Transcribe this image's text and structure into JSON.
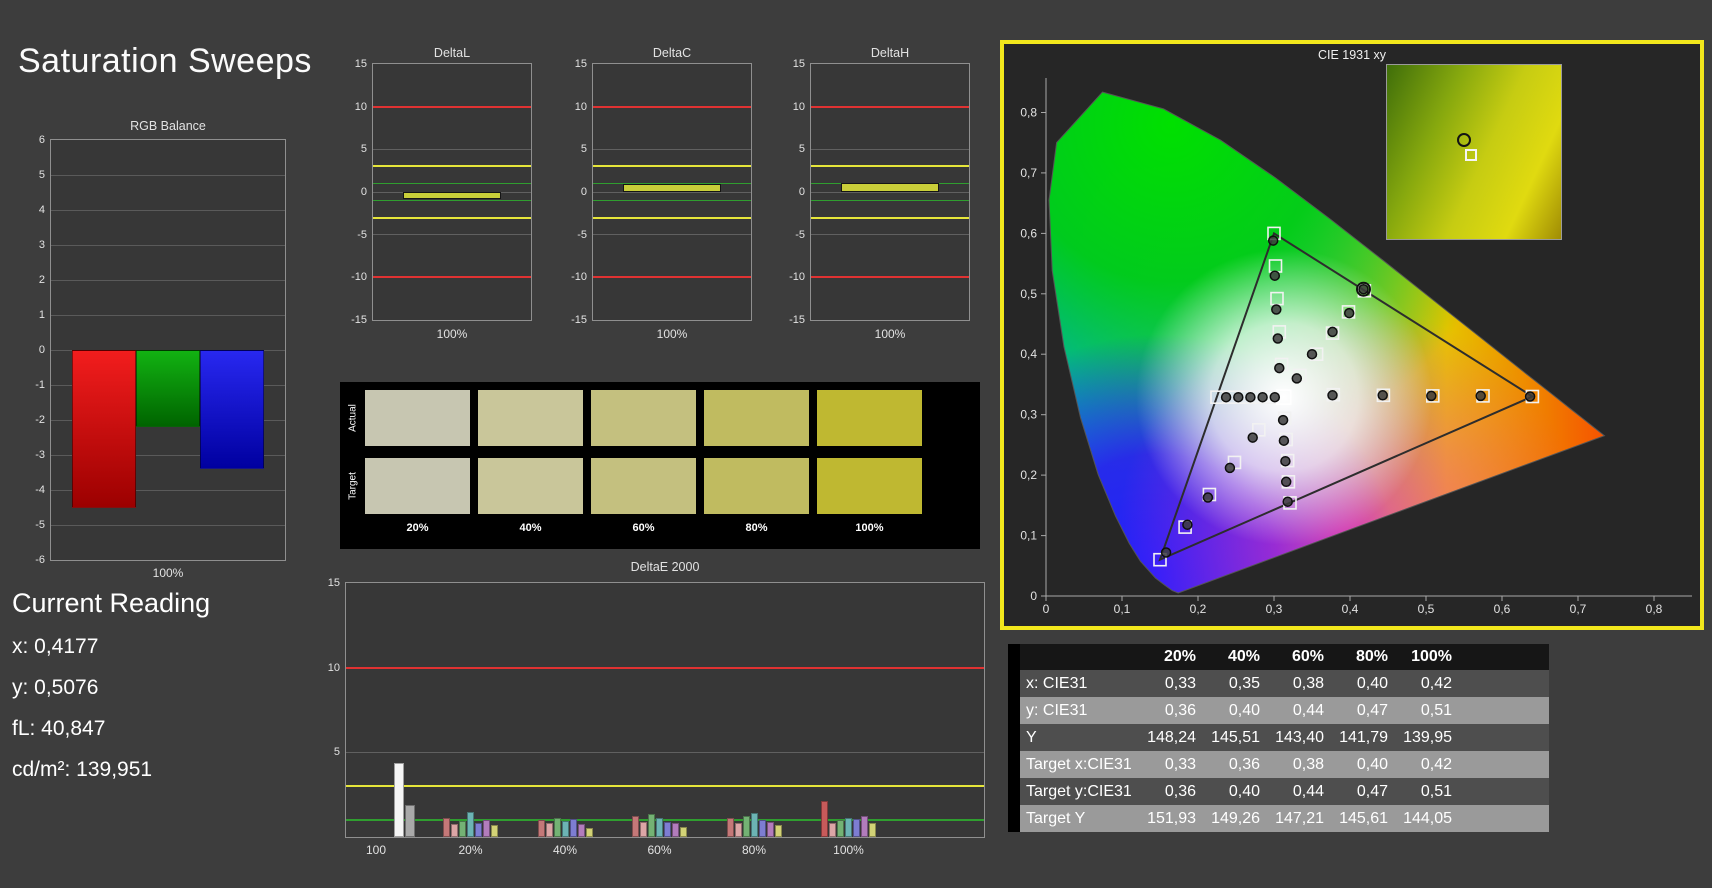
{
  "page": {
    "title": "Saturation Sweeps"
  },
  "current_reading": {
    "heading": "Current Reading",
    "lines": [
      "x: 0,4177",
      "y: 0,5076",
      "fL: 40,847",
      "cd/m²: 139,951"
    ]
  },
  "swatches": {
    "row_labels": [
      "Actual",
      "Target"
    ],
    "col_labels": [
      "20%",
      "40%",
      "60%",
      "80%",
      "100%"
    ],
    "actual_colors": [
      "#c7c6b1",
      "#c9c69a",
      "#c4c07f",
      "#c0bb60",
      "#bfb831"
    ],
    "target_colors": [
      "#c7c6b1",
      "#c9c69a",
      "#c4c07f",
      "#c0bb60",
      "#bfb831"
    ]
  },
  "table": {
    "columns": [
      "20%",
      "40%",
      "60%",
      "80%",
      "100%"
    ],
    "rows": [
      {
        "label": "x: CIE31",
        "values": [
          "0,33",
          "0,35",
          "0,38",
          "0,40",
          "0,42"
        ]
      },
      {
        "label": "y: CIE31",
        "values": [
          "0,36",
          "0,40",
          "0,44",
          "0,47",
          "0,51"
        ]
      },
      {
        "label": "Y",
        "values": [
          "148,24",
          "145,51",
          "143,40",
          "141,79",
          "139,95"
        ]
      },
      {
        "label": "Target x:CIE31",
        "values": [
          "0,33",
          "0,36",
          "0,38",
          "0,40",
          "0,42"
        ]
      },
      {
        "label": "Target y:CIE31",
        "values": [
          "0,36",
          "0,40",
          "0,44",
          "0,47",
          "0,51"
        ]
      },
      {
        "label": "Target Y",
        "values": [
          "151,93",
          "149,26",
          "147,21",
          "145,61",
          "144,05"
        ]
      }
    ]
  },
  "chart_data": [
    {
      "id": "rgb_balance",
      "type": "bar",
      "title": "RGB Balance",
      "xlabel": "100%",
      "ylim": [
        -6,
        6
      ],
      "yticks": [
        6,
        5,
        4,
        3,
        2,
        1,
        0,
        -1,
        -2,
        -3,
        -4,
        -5,
        -6
      ],
      "categories": [
        "Red",
        "Green",
        "Blue"
      ],
      "values": [
        -4.5,
        -2.2,
        -3.4
      ],
      "colors": [
        [
          "#f21d1d",
          "#9c0000"
        ],
        [
          "#12b212",
          "#006400"
        ],
        [
          "#2828f0",
          "#0000a0"
        ]
      ]
    },
    {
      "id": "deltaL",
      "type": "bar",
      "title": "DeltaL",
      "xlabel": "100%",
      "ylim": [
        -15,
        15
      ],
      "yticks": [
        15,
        10,
        5,
        0,
        -5,
        -10,
        -15
      ],
      "limits": {
        "red": 10,
        "yellow": 3,
        "green": 1
      },
      "categories": [
        "100%"
      ],
      "values": [
        -0.8
      ],
      "bar_color": "#c9ce39"
    },
    {
      "id": "deltaC",
      "type": "bar",
      "title": "DeltaC",
      "xlabel": "100%",
      "ylim": [
        -15,
        15
      ],
      "yticks": [
        15,
        10,
        5,
        0,
        -5,
        -10,
        -15
      ],
      "limits": {
        "red": 10,
        "yellow": 3,
        "green": 1
      },
      "categories": [
        "100%"
      ],
      "values": [
        0.9
      ],
      "bar_color": "#c9ce39"
    },
    {
      "id": "deltaH",
      "type": "bar",
      "title": "DeltaH",
      "xlabel": "100%",
      "ylim": [
        -15,
        15
      ],
      "yticks": [
        15,
        10,
        5,
        0,
        -5,
        -10,
        -15
      ],
      "limits": {
        "red": 10,
        "yellow": 3,
        "green": 1
      },
      "categories": [
        "100%"
      ],
      "values": [
        1.0
      ],
      "bar_color": "#c9ce39"
    },
    {
      "id": "deltaE2000",
      "type": "bar",
      "title": "DeltaE 2000",
      "ylim": [
        0,
        15
      ],
      "yticks": [
        15,
        10,
        5
      ],
      "limits": {
        "red": 10,
        "yellow": 3,
        "green": 1
      },
      "groups": [
        {
          "label": "100",
          "bars": [
            {
              "color": "#f5f5f5",
              "value": 4.35
            },
            {
              "color": "#a9a9a9",
              "value": 1.9
            }
          ]
        },
        {
          "label": "20%",
          "bars": [
            {
              "color": "#c47878",
              "value": 1.15
            },
            {
              "color": "#dca6a6",
              "value": 0.75
            },
            {
              "color": "#74b274",
              "value": 0.95
            },
            {
              "color": "#6cb4b4",
              "value": 1.45
            },
            {
              "color": "#7d7dd2",
              "value": 0.8
            },
            {
              "color": "#b27cbc",
              "value": 1.0
            },
            {
              "color": "#d2d276",
              "value": 0.7
            }
          ]
        },
        {
          "label": "40%",
          "bars": [
            {
              "color": "#c47878",
              "value": 1.0
            },
            {
              "color": "#dca6a6",
              "value": 0.85
            },
            {
              "color": "#74b274",
              "value": 1.15
            },
            {
              "color": "#6cb4b4",
              "value": 0.95
            },
            {
              "color": "#7d7dd2",
              "value": 1.05
            },
            {
              "color": "#b27cbc",
              "value": 0.75
            },
            {
              "color": "#d2d276",
              "value": 0.55
            }
          ]
        },
        {
          "label": "60%",
          "bars": [
            {
              "color": "#c47878",
              "value": 1.25
            },
            {
              "color": "#dca6a6",
              "value": 0.9
            },
            {
              "color": "#74b274",
              "value": 1.35
            },
            {
              "color": "#6cb4b4",
              "value": 1.15
            },
            {
              "color": "#7d7dd2",
              "value": 0.9
            },
            {
              "color": "#b27cbc",
              "value": 0.8
            },
            {
              "color": "#d2d276",
              "value": 0.6
            }
          ]
        },
        {
          "label": "80%",
          "bars": [
            {
              "color": "#c47878",
              "value": 1.15
            },
            {
              "color": "#dca6a6",
              "value": 0.8
            },
            {
              "color": "#74b274",
              "value": 1.25
            },
            {
              "color": "#6cb4b4",
              "value": 1.4
            },
            {
              "color": "#7d7dd2",
              "value": 1.0
            },
            {
              "color": "#b27cbc",
              "value": 0.9
            },
            {
              "color": "#d2d276",
              "value": 0.7
            }
          ]
        },
        {
          "label": "100%",
          "bars": [
            {
              "color": "#c85a5a",
              "value": 2.15
            },
            {
              "color": "#dca6a6",
              "value": 0.8
            },
            {
              "color": "#74b274",
              "value": 1.0
            },
            {
              "color": "#6cb4b4",
              "value": 1.1
            },
            {
              "color": "#7d7dd2",
              "value": 1.05
            },
            {
              "color": "#b27cbc",
              "value": 1.25
            },
            {
              "color": "#d2d276",
              "value": 0.85
            }
          ]
        }
      ]
    },
    {
      "id": "cie_1931_xy",
      "type": "scatter",
      "title": "CIE 1931 xy",
      "xlim": [
        0,
        0.85
      ],
      "ylim": [
        0,
        0.857
      ],
      "x_tick_labels": [
        "0",
        "0,1",
        "0,2",
        "0,3",
        "0,4",
        "0,5",
        "0,6",
        "0,7",
        "0,8"
      ],
      "y_tick_labels": [
        "0",
        "0,1",
        "0,2",
        "0,3",
        "0,4",
        "0,5",
        "0,6",
        "0,7",
        "0,8"
      ],
      "gamut_triangle": [
        [
          0.64,
          0.33
        ],
        [
          0.3,
          0.6
        ],
        [
          0.15,
          0.06
        ]
      ],
      "white_point": [
        0.3127,
        0.329
      ],
      "current": [
        0.4177,
        0.5076
      ],
      "targets": [
        [
          0.378,
          0.333
        ],
        [
          0.444,
          0.332
        ],
        [
          0.509,
          0.331
        ],
        [
          0.575,
          0.331
        ],
        [
          0.64,
          0.33
        ],
        [
          0.31,
          0.383
        ],
        [
          0.307,
          0.437
        ],
        [
          0.304,
          0.492
        ],
        [
          0.302,
          0.546
        ],
        [
          0.3,
          0.6
        ],
        [
          0.28,
          0.275
        ],
        [
          0.248,
          0.221
        ],
        [
          0.215,
          0.168
        ],
        [
          0.183,
          0.114
        ],
        [
          0.15,
          0.06
        ],
        [
          0.334,
          0.365
        ],
        [
          0.356,
          0.4
        ],
        [
          0.377,
          0.435
        ],
        [
          0.398,
          0.47
        ],
        [
          0.419,
          0.505
        ],
        [
          0.295,
          0.329
        ],
        [
          0.278,
          0.329
        ],
        [
          0.26,
          0.329
        ],
        [
          0.243,
          0.329
        ],
        [
          0.225,
          0.329
        ],
        [
          0.314,
          0.294
        ],
        [
          0.316,
          0.259
        ],
        [
          0.318,
          0.224
        ],
        [
          0.319,
          0.189
        ],
        [
          0.321,
          0.154
        ]
      ],
      "measurements": [
        [
          0.377,
          0.332
        ],
        [
          0.443,
          0.332
        ],
        [
          0.507,
          0.331
        ],
        [
          0.572,
          0.331
        ],
        [
          0.637,
          0.33
        ],
        [
          0.307,
          0.377
        ],
        [
          0.305,
          0.426
        ],
        [
          0.303,
          0.474
        ],
        [
          0.301,
          0.53
        ],
        [
          0.299,
          0.588
        ],
        [
          0.272,
          0.262
        ],
        [
          0.242,
          0.212
        ],
        [
          0.213,
          0.163
        ],
        [
          0.186,
          0.118
        ],
        [
          0.158,
          0.072
        ],
        [
          0.33,
          0.36
        ],
        [
          0.35,
          0.4
        ],
        [
          0.377,
          0.437
        ],
        [
          0.399,
          0.468
        ],
        [
          0.4177,
          0.5076
        ],
        [
          0.301,
          0.329
        ],
        [
          0.285,
          0.329
        ],
        [
          0.269,
          0.329
        ],
        [
          0.253,
          0.329
        ],
        [
          0.237,
          0.329
        ],
        [
          0.312,
          0.291
        ],
        [
          0.313,
          0.257
        ],
        [
          0.315,
          0.223
        ],
        [
          0.316,
          0.189
        ],
        [
          0.318,
          0.156
        ]
      ]
    }
  ]
}
